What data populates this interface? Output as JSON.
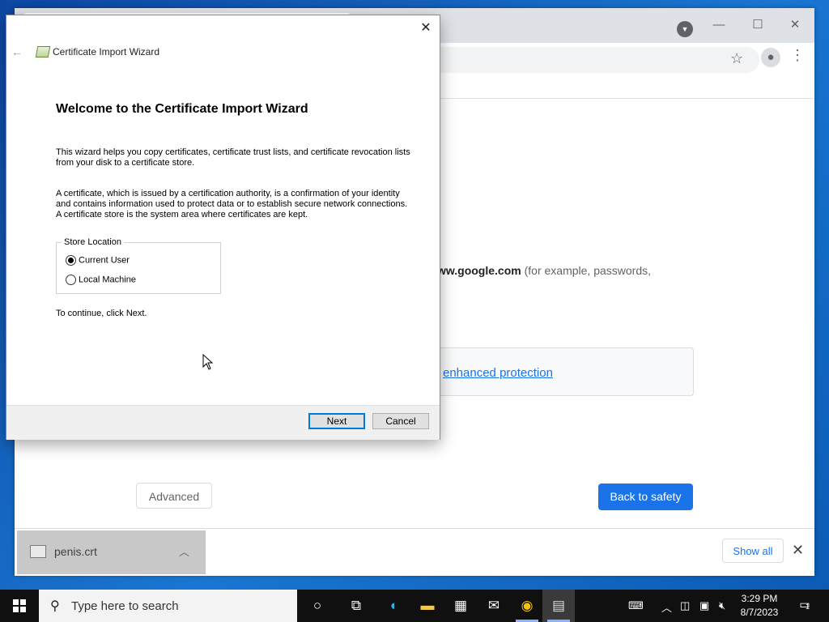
{
  "browser": {
    "window_controls": {
      "minimize": "—",
      "maximize": "☐",
      "close": "✕"
    },
    "interstitial": {
      "domain_bold": "ww.google.com",
      "domain_suffix": " (for example, passwords,",
      "protection_link": "enhanced protection",
      "advanced_label": "Advanced",
      "back_to_safety_label": "Back to safety"
    },
    "download_shelf": {
      "file_name": "penis.crt",
      "show_all_label": "Show all"
    }
  },
  "wizard": {
    "title": "Certificate Import Wizard",
    "heading": "Welcome to the Certificate Import Wizard",
    "para1": "This wizard helps you copy certificates, certificate trust lists, and certificate revocation lists from your disk to a certificate store.",
    "para2": "A certificate, which is issued by a certification authority, is a confirmation of your identity and contains information used to protect data or to establish secure network connections. A certificate store is the system area where certificates are kept.",
    "store_location": {
      "legend": "Store Location",
      "options": [
        {
          "label": "Current User",
          "checked": true
        },
        {
          "label": "Local Machine",
          "checked": false
        }
      ]
    },
    "continue_text": "To continue, click Next.",
    "next_label": "Next",
    "cancel_label": "Cancel"
  },
  "taskbar": {
    "search_placeholder": "Type here to search",
    "clock_time": "3:29 PM",
    "clock_date": "8/7/2023",
    "notification_count": "1"
  }
}
